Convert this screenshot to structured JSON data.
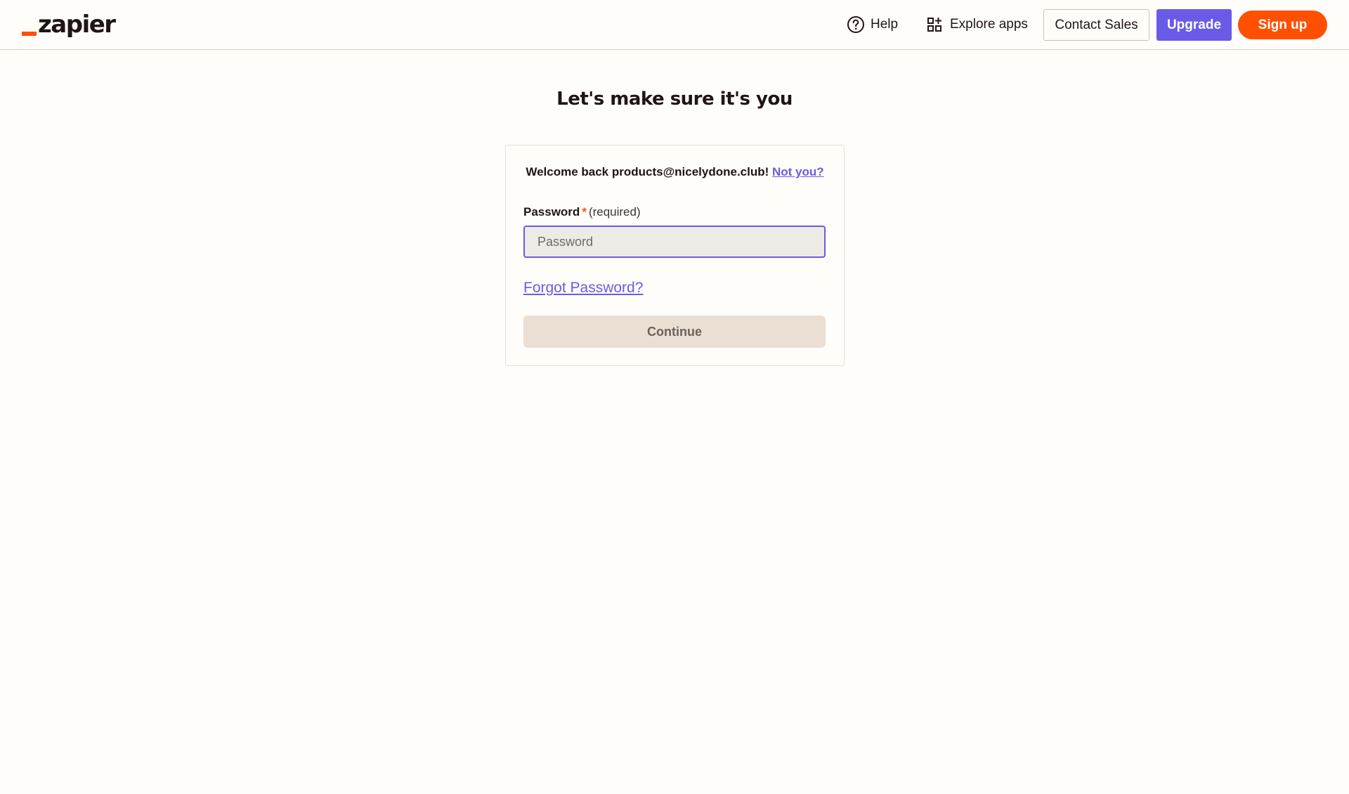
{
  "header": {
    "logo_text": "zapier",
    "help_label": "Help",
    "explore_label": "Explore apps",
    "contact_label": "Contact Sales",
    "upgrade_label": "Upgrade",
    "signup_label": "Sign up",
    "icons": {
      "help": "question-circle-icon",
      "explore": "apps-grid-icon"
    }
  },
  "main": {
    "title": "Let's make sure it's you",
    "welcome_text": "Welcome back products@nicelydone.club!",
    "not_you_label": "Not you?",
    "password_label": "Password",
    "required_star": "*",
    "required_text": "(required)",
    "password_value": "",
    "password_placeholder": "Password",
    "forgot_label": "Forgot Password?",
    "continue_label": "Continue"
  },
  "colors": {
    "brand_orange": "#ff4f00",
    "accent_purple": "#695be8",
    "background": "#fffdf9",
    "continue_disabled_bg": "#ebdfd3"
  }
}
